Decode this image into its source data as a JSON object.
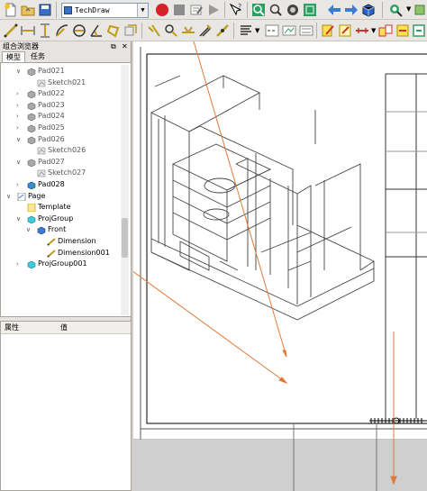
{
  "toolbar": {
    "workbench": "TechDraw",
    "colors": {
      "record": "#d6202a",
      "accent": "#3a7bd5",
      "ruler": "#d12f2f"
    },
    "row1_icons": [
      "new-document-icon",
      "open-folder-icon",
      "save-icon",
      "workbench-select",
      "record-macro-icon",
      "stop-macro-icon",
      "edit-macro-icon",
      "run-macro-icon",
      "whats-this-icon",
      "fit-all-icon",
      "fit-selection-icon",
      "draw-style-icon",
      "box-selection-icon",
      "back-arrow-icon",
      "forward-arrow-icon",
      "sync-view-icon",
      "view-cube-icon",
      "zoom-icon"
    ],
    "row2_icons": [
      "dimension-length-icon",
      "dimension-horizontal-icon",
      "dimension-vertical-icon",
      "dimension-radius-icon",
      "dimension-diameter-icon",
      "dimension-angle-icon",
      "dimension-3pt-angle-icon",
      "dimension-link-icon",
      "balloon-icon",
      "leader-icon",
      "weld-symbol-icon",
      "hatch-icon",
      "cosmetic-vertex-icon",
      "centerline-icon",
      "annotation-icon",
      "export-svg-icon",
      "export-dxf-icon",
      "redraw-icon",
      "toggle-frames-icon",
      "projection-group-icon",
      "view-section-icon"
    ]
  },
  "combo": {
    "title": "组合浏览器",
    "tabs": [
      "模型",
      "任务"
    ],
    "props_headers": [
      "属性",
      "值"
    ],
    "tree": [
      {
        "label": "Pad021",
        "arrow": "∨",
        "type": "pad",
        "level": 1,
        "gray": true
      },
      {
        "label": "Sketch021",
        "arrow": "",
        "type": "sketch",
        "level": 2,
        "gray": true
      },
      {
        "label": "Pad022",
        "arrow": "›",
        "type": "pad",
        "level": 1,
        "gray": true
      },
      {
        "label": "Pad023",
        "arrow": "›",
        "type": "pad",
        "level": 1,
        "gray": true
      },
      {
        "label": "Pad024",
        "arrow": "›",
        "type": "pad",
        "level": 1,
        "gray": true
      },
      {
        "label": "Pad025",
        "arrow": "›",
        "type": "pad",
        "level": 1,
        "gray": true
      },
      {
        "label": "Pad026",
        "arrow": "∨",
        "type": "pad",
        "level": 1,
        "gray": true
      },
      {
        "label": "Sketch026",
        "arrow": "",
        "type": "sketch",
        "level": 2,
        "gray": true
      },
      {
        "label": "Pad027",
        "arrow": "∨",
        "type": "pad",
        "level": 1,
        "gray": true
      },
      {
        "label": "Sketch027",
        "arrow": "",
        "type": "sketch",
        "level": 2,
        "gray": true
      },
      {
        "label": "Pad028",
        "arrow": "›",
        "type": "pad-active",
        "level": 1,
        "gray": false
      },
      {
        "label": "Page",
        "arrow": "∨",
        "type": "page",
        "level": 0,
        "gray": false
      },
      {
        "label": "Template",
        "arrow": "",
        "type": "template",
        "level": 1,
        "gray": false
      },
      {
        "label": "ProjGroup",
        "arrow": "∨",
        "type": "projgroup",
        "level": 1,
        "gray": false
      },
      {
        "label": "Front",
        "arrow": "∨",
        "type": "view",
        "level": 2,
        "gray": false
      },
      {
        "label": "Dimension",
        "arrow": "",
        "type": "dimension",
        "level": 3,
        "gray": false
      },
      {
        "label": "Dimension001",
        "arrow": "",
        "type": "dimension",
        "level": 3,
        "gray": false
      },
      {
        "label": "ProjGroup001",
        "arrow": "›",
        "type": "projgroup",
        "level": 1,
        "gray": false
      }
    ]
  }
}
